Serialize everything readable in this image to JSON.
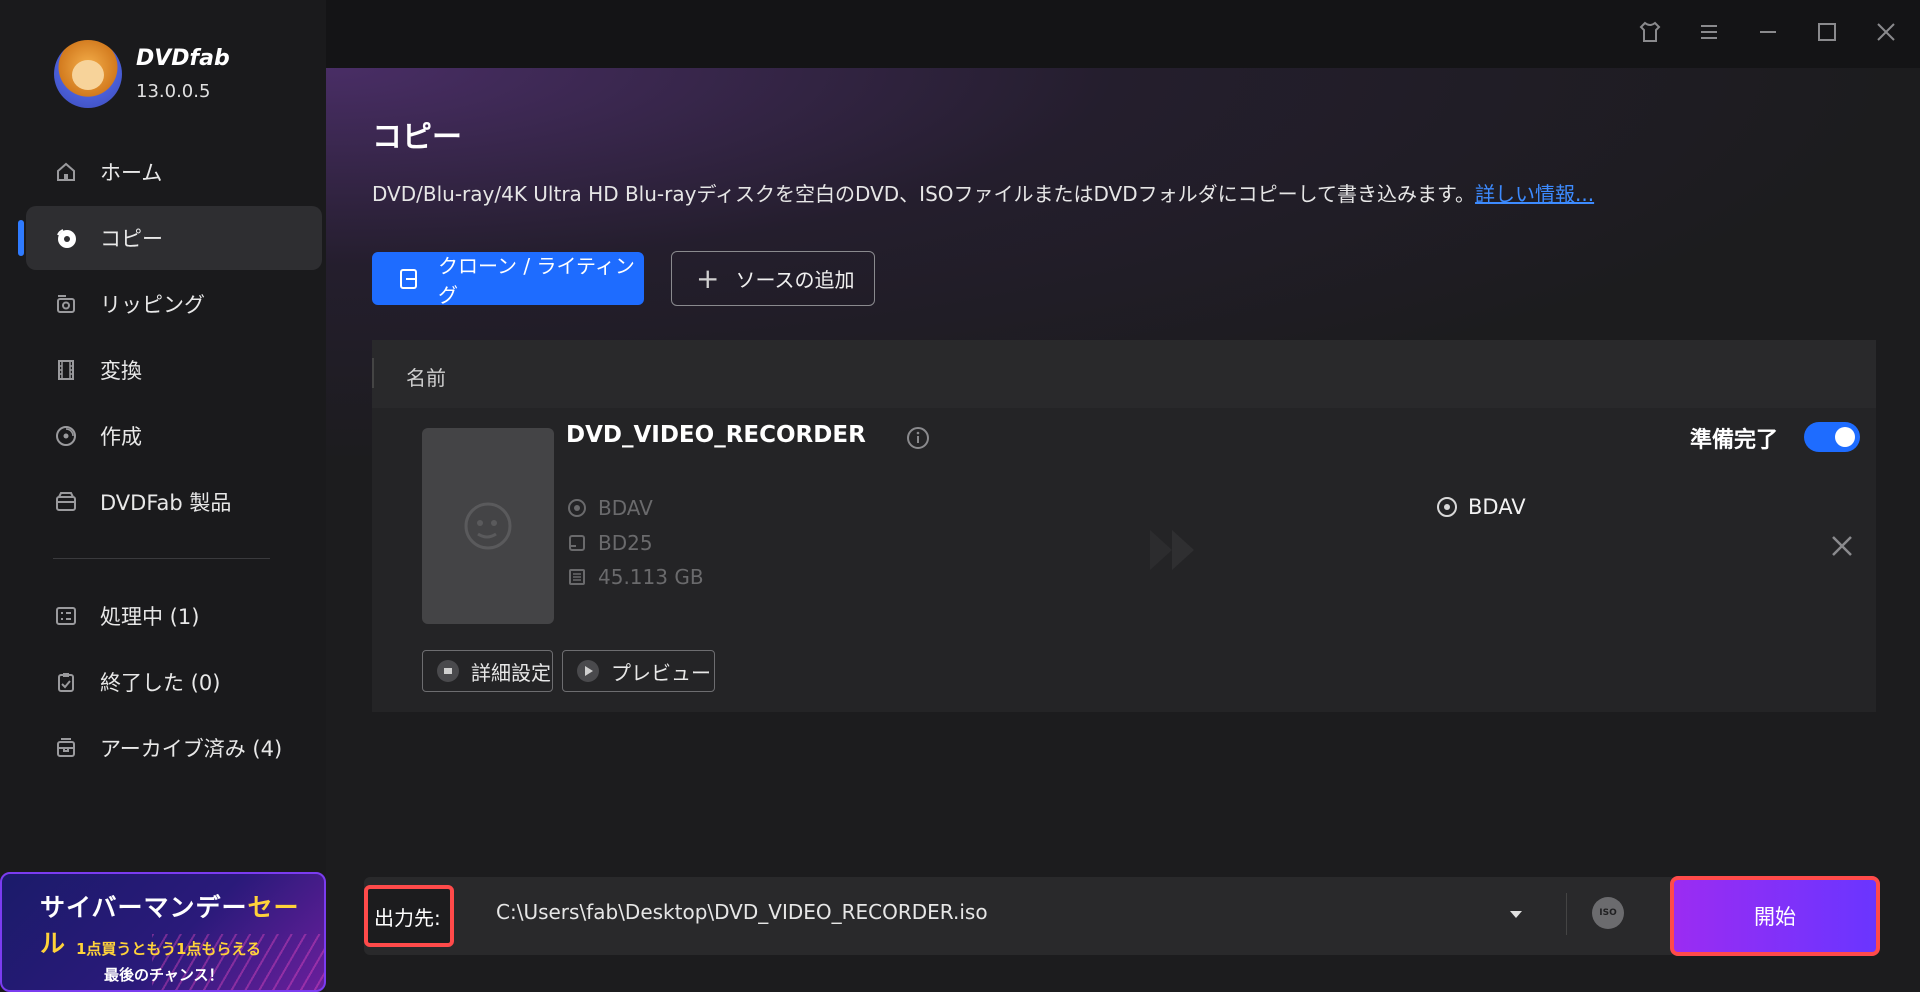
{
  "app": {
    "brand": "DVDfab",
    "version": "13.0.0.5"
  },
  "sidebar": {
    "items": [
      {
        "label": "ホーム",
        "icon": "home-icon"
      },
      {
        "label": "コピー",
        "icon": "copy-disc-icon",
        "active": true
      },
      {
        "label": "リッピング",
        "icon": "ripper-icon"
      },
      {
        "label": "変換",
        "icon": "film-icon"
      },
      {
        "label": "作成",
        "icon": "creator-disc-icon"
      },
      {
        "label": "DVDFab 製品",
        "icon": "box-icon"
      }
    ],
    "tasks": [
      {
        "label": "処理中 (1)",
        "icon": "processing-list-icon"
      },
      {
        "label": "終了した (0)",
        "icon": "finished-clipboard-icon"
      },
      {
        "label": "アーカイブ済み (4)",
        "icon": "archive-icon"
      }
    ],
    "promo": {
      "title_a": "サイバーマンデー",
      "title_b": "セール",
      "line1": "1点買うともう1点もらえる",
      "line2": "最後のチャンス！"
    }
  },
  "main": {
    "title": "コピー",
    "description": "DVD/Blu-ray/4K Ultra HD Blu-rayディスクを空白のDVD、ISOファイルまたはDVDフォルダにコピーして書き込みます。",
    "more_link": "詳しい情報...",
    "mode_button": "クローン / ライティング",
    "add_source_button": "ソースの追加",
    "table": {
      "col_name": "名前",
      "item": {
        "title": "DVD_VIDEO_RECORDER",
        "source_format": "BDAV",
        "disc_type": "BD25",
        "size": "45.113 GB",
        "target_format": "BDAV",
        "status": "準備完了",
        "status_enabled": true,
        "settings_button": "詳細設定",
        "preview_button": "プレビュー"
      }
    },
    "output": {
      "label": "出力先:",
      "path": "C:\\Users\\fab\\Desktop\\DVD_VIDEO_RECORDER.iso",
      "iso_badge": "ISO"
    },
    "start_button": "開始"
  },
  "colors": {
    "accent": "#1e6cff",
    "highlight_red": "#ff4a4a",
    "start_gradient": "#9b2cf2",
    "link": "#3d8bff"
  }
}
